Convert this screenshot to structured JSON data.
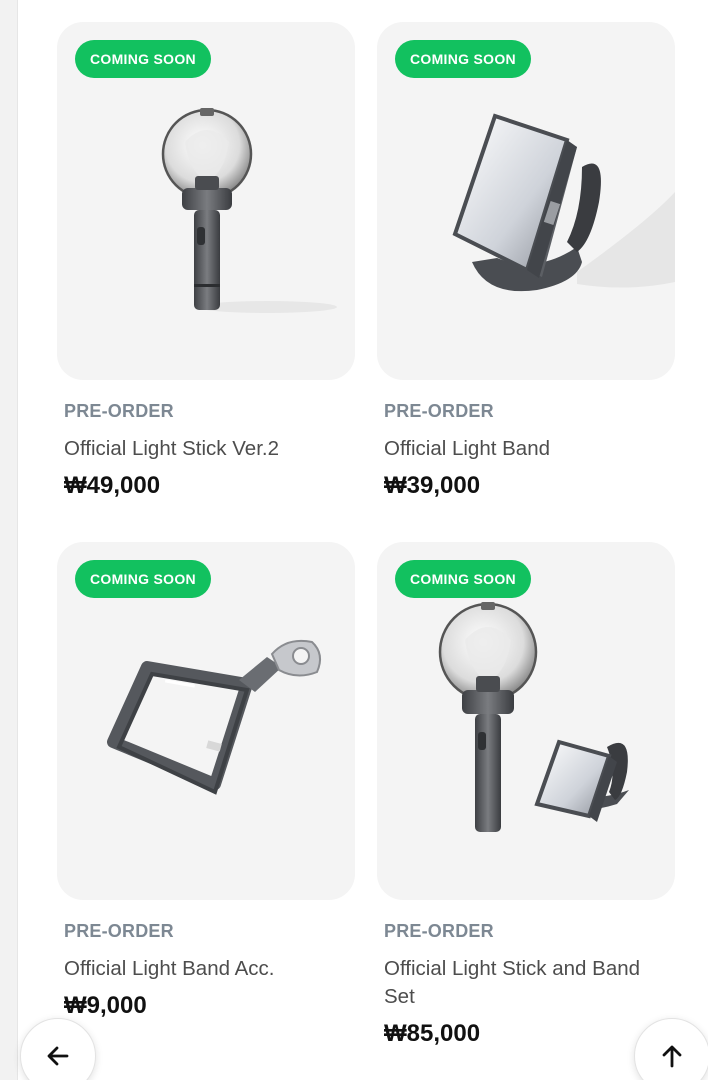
{
  "products": [
    {
      "badge": "COMING SOON",
      "tag": "PRE-ORDER",
      "name": "Official Light Stick Ver.2",
      "price": "₩49,000",
      "image": "light-stick-image"
    },
    {
      "badge": "COMING SOON",
      "tag": "PRE-ORDER",
      "name": "Official Light Band",
      "price": "₩39,000",
      "image": "light-band-image"
    },
    {
      "badge": "COMING SOON",
      "tag": "PRE-ORDER",
      "name": "Official Light Band Acc.",
      "price": "₩9,000",
      "image": "light-band-holder-image"
    },
    {
      "badge": "COMING SOON",
      "tag": "PRE-ORDER",
      "name": "Official Light Stick and Band Set",
      "price": "₩85,000",
      "image": "light-stick-band-set-image"
    }
  ],
  "controls": {
    "back_icon": "arrow-left-icon",
    "top_icon": "arrow-up-icon"
  },
  "colors": {
    "badge": "#12c15f",
    "tag": "#7d8893",
    "thumb_bg": "#f4f4f4"
  }
}
